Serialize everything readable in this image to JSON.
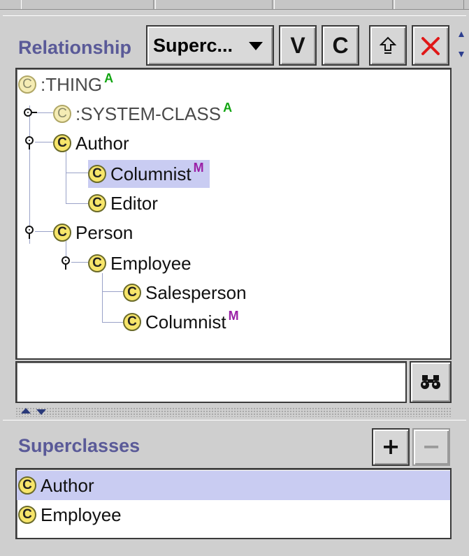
{
  "header": {
    "label": "Relationship",
    "combo_value": "Superc...",
    "buttons": {
      "view": "V",
      "create": "C",
      "up": "⇪",
      "delete": "✕"
    }
  },
  "tree": {
    "nodes": [
      {
        "label": ":THING",
        "badge": "A"
      },
      {
        "label": ":SYSTEM-CLASS",
        "badge": "A"
      },
      {
        "label": "Author",
        "badge": ""
      },
      {
        "label": "Columnist",
        "badge": "M"
      },
      {
        "label": "Editor",
        "badge": ""
      },
      {
        "label": "Person",
        "badge": ""
      },
      {
        "label": "Employee",
        "badge": ""
      },
      {
        "label": "Salesperson",
        "badge": ""
      },
      {
        "label": "Columnist",
        "badge": "M"
      }
    ],
    "class_icon_letter": "C"
  },
  "search": {
    "value": "",
    "button_icon": "binoculars-icon"
  },
  "superclasses": {
    "title": "Superclasses",
    "add_label": "+",
    "remove_label": "−",
    "items": [
      {
        "label": "Author"
      },
      {
        "label": "Employee"
      }
    ]
  },
  "colors": {
    "panel_title": "#5a5a98",
    "selection": "#c9ccf2",
    "class_icon": "#f7e56a",
    "badge_a": "#12a512",
    "badge_m": "#9a1fa6",
    "delete_red": "#e01818"
  }
}
